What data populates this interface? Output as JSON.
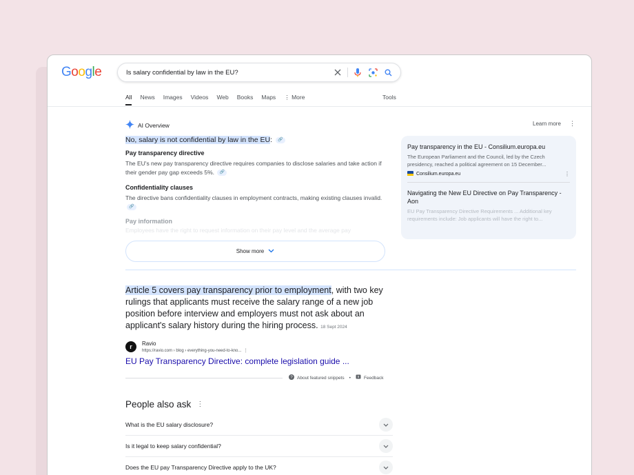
{
  "search": {
    "query": "Is salary confidential by law in the EU?"
  },
  "logo": {
    "letters": [
      "G",
      "o",
      "o",
      "g",
      "l",
      "e"
    ],
    "colors": [
      "#4285f4",
      "#ea4335",
      "#fbbc05",
      "#4285f4",
      "#34a853",
      "#ea4335"
    ]
  },
  "tabs": [
    {
      "label": "All",
      "active": true
    },
    {
      "label": "News"
    },
    {
      "label": "Images"
    },
    {
      "label": "Videos"
    },
    {
      "label": "Web"
    },
    {
      "label": "Books"
    },
    {
      "label": "Maps"
    },
    {
      "label": "More",
      "icon": "more-vert-icon"
    }
  ],
  "tools_label": "Tools",
  "ai_overview": {
    "label": "AI Overview",
    "learn_more": "Learn more",
    "headline": "No, salary is not confidential by law in the EU",
    "sections": [
      {
        "title": "Pay transparency directive",
        "text": "The EU's new pay transparency directive requires companies to disclose salaries and take action if their gender pay gap exceeds 5%."
      },
      {
        "title": "Confidentiality clauses",
        "text": "The directive bans confidentiality clauses in employment contracts, making existing clauses invalid."
      }
    ],
    "faded_title": "Pay information",
    "faded_text": "Employees have the right to request information on their pay level and the average pay",
    "show_more": "Show more"
  },
  "sources": [
    {
      "title": "Pay transparency in the EU - Consilium.europa.eu",
      "desc": "The European Parliament and the Council, led by the Czech presidency, reached a political agreement on 15 December...",
      "site": "Consilium.europa.eu"
    },
    {
      "title": "Navigating the New EU Directive on Pay Transparency - Aon",
      "desc": "EU Pay Transparency Directive Requirements ... Additional key requirements include: Job applicants will have the right to..."
    }
  ],
  "snippet": {
    "highlight": "Article 5 covers pay transparency prior to employment",
    "rest": ", with two key rulings that applicants must receive the salary range of a new job position before interview and employers must not ask about an applicant's salary history during the hiring process.",
    "date": "18 Sept 2024",
    "site_name": "Ravio",
    "url": "https://ravio.com › blog › everything-you-need-to-kno...",
    "link_title": "EU Pay Transparency Directive: complete legislation guide ...",
    "about": "About featured snippets",
    "separator": "•",
    "feedback": "Feedback"
  },
  "paa": {
    "title": "People also ask",
    "questions": [
      "What is the EU salary disclosure?",
      "Is it legal to keep salary confidential?",
      "Does the EU pay Transparency Directive apply to the UK?"
    ]
  }
}
